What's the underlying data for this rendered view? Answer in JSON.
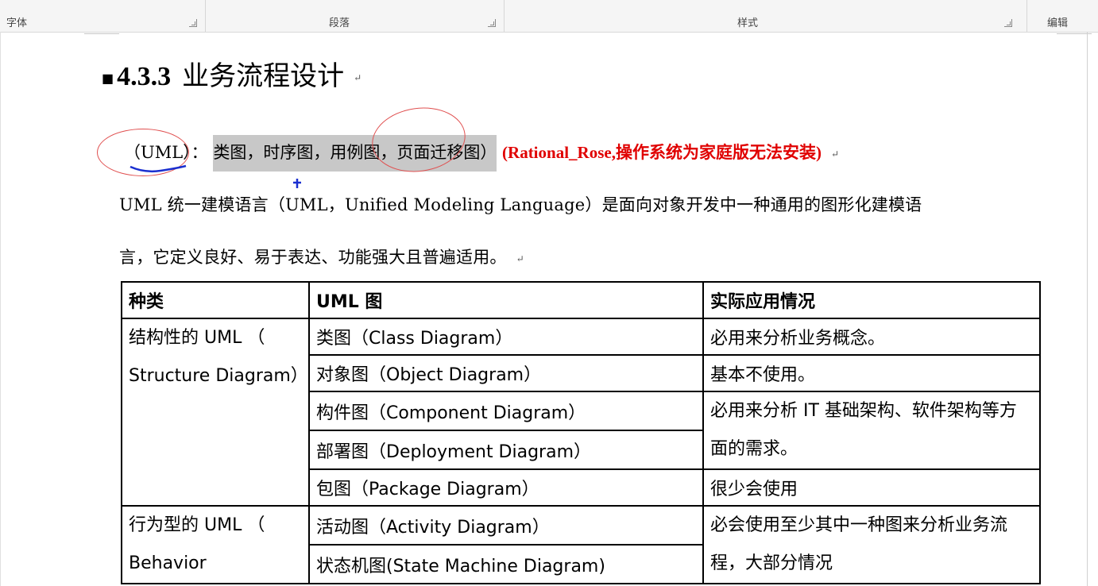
{
  "ribbon": {
    "groups": [
      "字体",
      "段落",
      "样式",
      "编辑"
    ]
  },
  "doc": {
    "heading_number": "4.3.3",
    "heading_title": "业务流程设计",
    "para_mark": "↵",
    "uml_label": "（UML）",
    "colon": "：",
    "highlight_text": "类图，时序图，用例图，页面迁移图）",
    "note_red": "(Rational_Rose,操作系统为家庭版无法安装)",
    "para1_line1": "UML 统一建模语言（UML，Unified Modeling Language）是面向对象开发中一种通用的图形化建模语",
    "para1_line2": "言，它定义良好、易于表达、功能强大且普遍适用。",
    "colors": {
      "red_note": "#e00000",
      "highlight": "#c8c8c8",
      "annotation_circle": "#e05050",
      "scribble": "#1a2fd0"
    }
  },
  "table": {
    "headers": [
      "种类",
      "UML 图",
      "实际应用情况"
    ],
    "structure_group": "结构性的 UML （ Structure Diagram）",
    "behavior_group": "行为型的 UML （ Behavior",
    "rows": [
      {
        "diagram": "类图（Class Diagram）",
        "usage": "必用来分析业务概念。"
      },
      {
        "diagram": "对象图（Object Diagram）",
        "usage": "基本不使用。"
      },
      {
        "diagram": "构件图（Component Diagram）",
        "usage": "必用来分析 IT 基础架构、软件架构等方面的需求。"
      },
      {
        "diagram": "部署图（Deployment Diagram）"
      },
      {
        "diagram": "包图（Package Diagram）",
        "usage": "很少会使用"
      },
      {
        "diagram": "活动图（Activity Diagram）",
        "usage": "必会使用至少其中一种图来分析业务流程，大部分情况"
      },
      {
        "diagram": "状态机图(State Machine Diagram)"
      }
    ]
  }
}
